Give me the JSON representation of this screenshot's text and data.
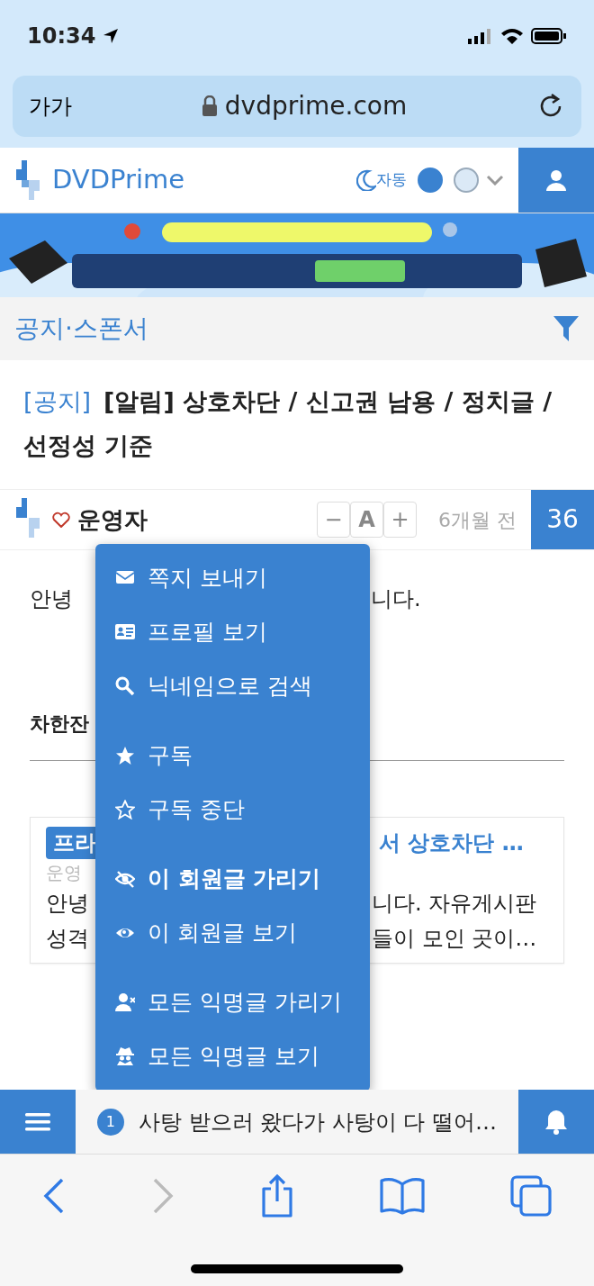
{
  "status_bar": {
    "time": "10:34"
  },
  "address_bar": {
    "text_size": "가가",
    "url": "dvdprime.com"
  },
  "header": {
    "logo": "DVDPrime",
    "theme_mode": "자동",
    "theme_colors": [
      {
        "color": "#3a82d0",
        "selected": true
      },
      {
        "color": "#dbe9f6",
        "selected": false
      }
    ]
  },
  "category": {
    "title": "공지·스폰서"
  },
  "post": {
    "tag": "[공지]",
    "title": "[알림] 상호차단 / 신고권 남용 / 정치글 / 선정성 기준",
    "author": "운영자",
    "font_controls": [
      "−",
      "A",
      "+"
    ],
    "time": "6개월 전",
    "comment_count": "36"
  },
  "body": {
    "line_1": {
      "left": "안녕",
      "right": "니다."
    },
    "heading": "차한잔",
    "card": {
      "badge": "프라",
      "title": "서 상호차단 …",
      "author": "운영",
      "line_1": {
        "left": "안녕",
        "right": "니다. 자유게시판"
      },
      "line_2": {
        "left": "성격",
        "right": "들이 모인 곳이…"
      }
    }
  },
  "user_menu": {
    "groups": [
      [
        {
          "kind": "mail",
          "label": "쪽지 보내기",
          "active": false
        },
        {
          "kind": "card",
          "label": "프로필 보기",
          "active": false
        },
        {
          "kind": "search",
          "label": "닉네임으로 검색",
          "active": false
        }
      ],
      [
        {
          "kind": "star",
          "label": "구독",
          "active": false
        },
        {
          "kind": "star-outline",
          "label": "구독 중단",
          "active": false
        }
      ],
      [
        {
          "kind": "eye-off",
          "label": "이 회원글 가리기",
          "active": true
        },
        {
          "kind": "eye",
          "label": "이 회원글 보기",
          "active": false
        }
      ],
      [
        {
          "kind": "user-x",
          "label": "모든 익명글 가리기",
          "active": false
        },
        {
          "kind": "spy",
          "label": "모든 익명글 보기",
          "active": false
        }
      ]
    ]
  },
  "notice_bar": {
    "count": "1",
    "text": "사탕 받으러 왔다가 사탕이 다 떨어…"
  }
}
